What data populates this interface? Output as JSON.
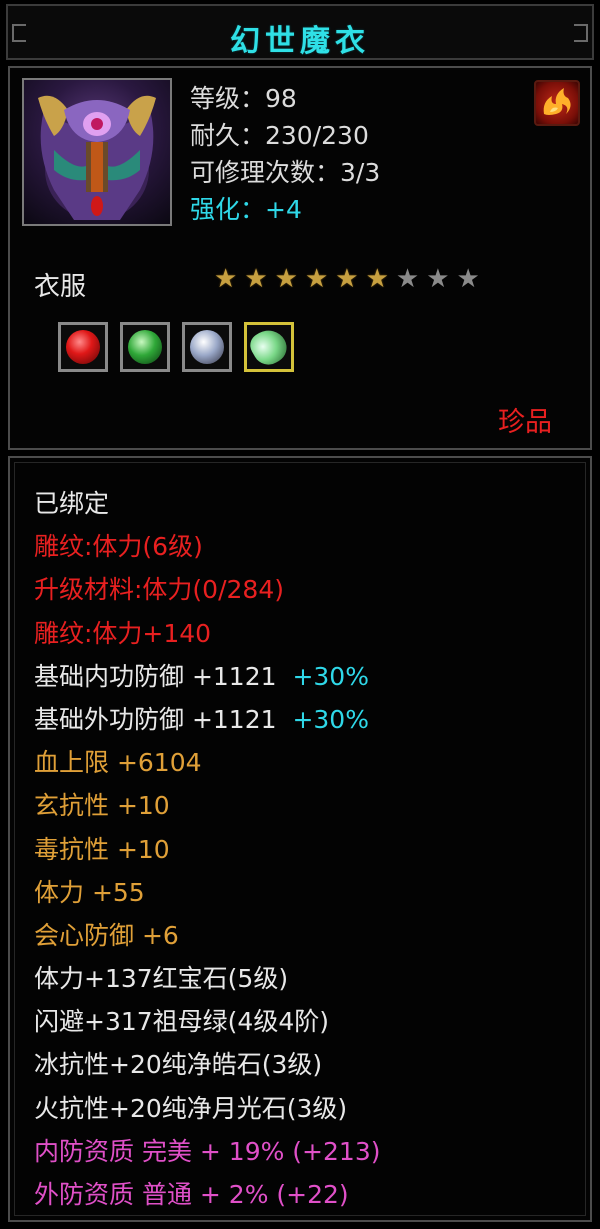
{
  "item": {
    "name": "幻世魔衣",
    "level_label": "等级：98",
    "durability_label": "耐久：230/230",
    "repair_label": "可修理次数：3/3",
    "enhance_label": "强化：+4",
    "type": "衣服",
    "stars": {
      "total": 9,
      "filled": 6
    },
    "rarity": "珍品",
    "portrait_icon": "robe-armor-icon",
    "badge_icon": "flame-icon",
    "gems": [
      {
        "icon": "red-gem-icon"
      },
      {
        "icon": "green-jade-gem-icon"
      },
      {
        "icon": "white-diamond-gem-icon"
      },
      {
        "icon": "moonstone-gem-icon",
        "selected": true
      }
    ]
  },
  "attributes": {
    "bound": "已绑定",
    "engraving": "雕纹:体力(6级)",
    "upgrade_material": "升级材料:体力(0/284)",
    "engraving_bonus": "雕纹:体力+140",
    "inner_def_label": "基础内功防御 +1121",
    "inner_def_pct": "+30%",
    "outer_def_label": "基础外功防御 +1121",
    "outer_def_pct": "+30%",
    "hp_max": "血上限 +6104",
    "mystic_res": "玄抗性 +10",
    "poison_res": "毒抗性 +10",
    "stamina": "体力 +55",
    "crit_def": "会心防御 +6",
    "gem_ruby": "体力+137红宝石(5级)",
    "gem_emerald": "闪避+317祖母绿(4级4阶)",
    "gem_diamond": "冰抗性+20纯净皓石(3级)",
    "gem_moonstone": "火抗性+20纯净月光石(3级)",
    "inner_quality": "内防资质 完美 + 19% (+213)",
    "outer_quality": "外防资质 普通 + 2% (+22)"
  },
  "colors": {
    "title": "#2fe0e6",
    "enhance": "#2fd8e8",
    "red": "#e82020",
    "gold": "#e0a038",
    "pink": "#e050c8",
    "star_gold": "#c7a040",
    "star_gray": "#8a8a8a"
  }
}
